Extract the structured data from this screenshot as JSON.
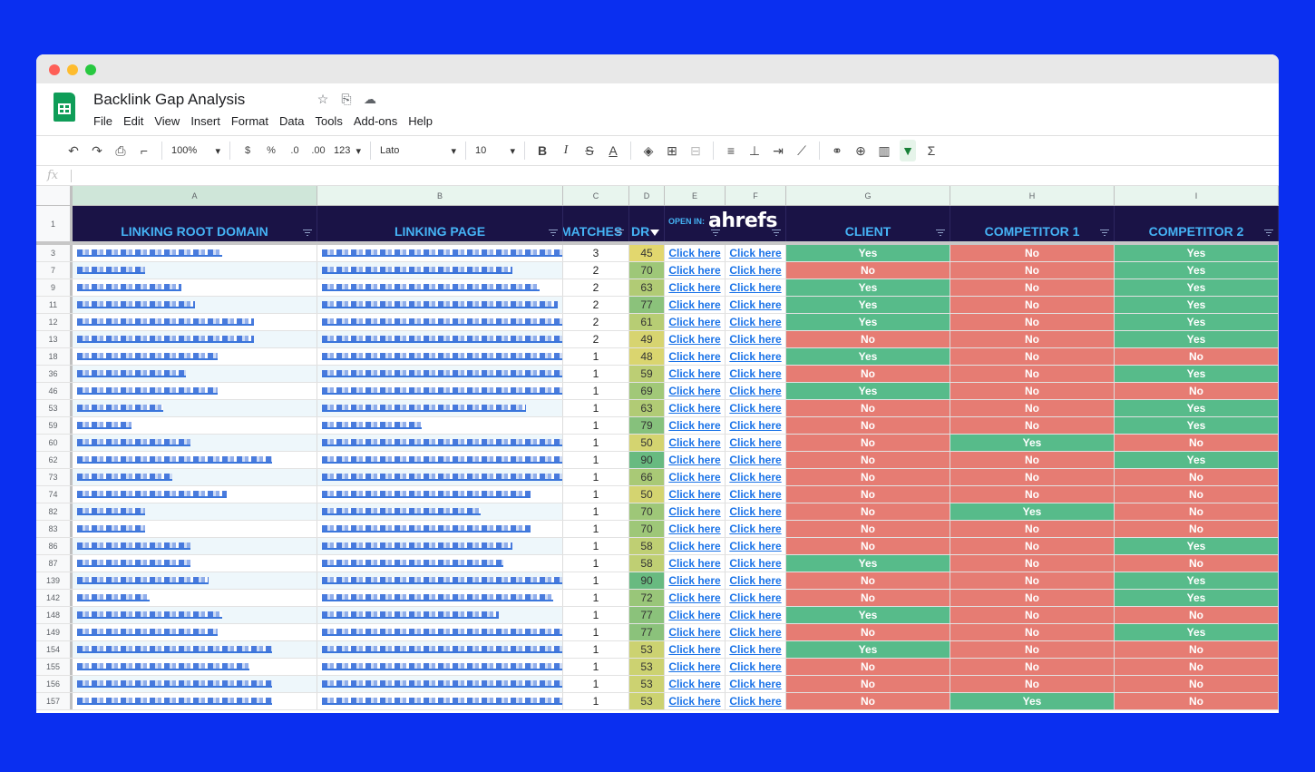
{
  "doc": {
    "title": "Backlink Gap Analysis",
    "menu": [
      "File",
      "Edit",
      "View",
      "Insert",
      "Format",
      "Data",
      "Tools",
      "Add-ons",
      "Help"
    ]
  },
  "toolbar": {
    "zoom": "100%",
    "currency": "$",
    "percent": "%",
    "dec_decrease": ".0",
    "dec_increase": ".00",
    "format_more": "123",
    "font": "Lato",
    "font_size": "10"
  },
  "formula": {
    "fx": "fx"
  },
  "columns": [
    "A",
    "B",
    "C",
    "D",
    "E",
    "F",
    "G",
    "H",
    "I"
  ],
  "header_row_number": "1",
  "headers": {
    "a": "LINKING ROOT DOMAIN",
    "b": "LINKING PAGE",
    "c": "MATCHES",
    "d": "DR",
    "e_open": "OPEN IN:",
    "e_brand": "ahrefs",
    "g": "CLIENT",
    "h": "COMPETITOR 1",
    "i": "COMPETITOR 2"
  },
  "link_text": "Click here",
  "colors": {
    "yes": "#57bb8a",
    "no": "#e67c73",
    "header_bg": "#1a1346",
    "header_text": "#45b3f5"
  },
  "rows": [
    {
      "n": "3",
      "matches": "3",
      "dr": 45,
      "client": "Yes",
      "c1": "No",
      "c2": "Yes"
    },
    {
      "n": "7",
      "matches": "2",
      "dr": 70,
      "client": "No",
      "c1": "No",
      "c2": "Yes"
    },
    {
      "n": "9",
      "matches": "2",
      "dr": 63,
      "client": "Yes",
      "c1": "No",
      "c2": "Yes"
    },
    {
      "n": "11",
      "matches": "2",
      "dr": 77,
      "client": "Yes",
      "c1": "No",
      "c2": "Yes"
    },
    {
      "n": "12",
      "matches": "2",
      "dr": 61,
      "client": "Yes",
      "c1": "No",
      "c2": "Yes"
    },
    {
      "n": "13",
      "matches": "2",
      "dr": 49,
      "client": "No",
      "c1": "No",
      "c2": "Yes"
    },
    {
      "n": "18",
      "matches": "1",
      "dr": 48,
      "client": "Yes",
      "c1": "No",
      "c2": "No"
    },
    {
      "n": "36",
      "matches": "1",
      "dr": 59,
      "client": "No",
      "c1": "No",
      "c2": "Yes"
    },
    {
      "n": "46",
      "matches": "1",
      "dr": 69,
      "client": "Yes",
      "c1": "No",
      "c2": "No"
    },
    {
      "n": "53",
      "matches": "1",
      "dr": 63,
      "client": "No",
      "c1": "No",
      "c2": "Yes"
    },
    {
      "n": "59",
      "matches": "1",
      "dr": 79,
      "client": "No",
      "c1": "No",
      "c2": "Yes"
    },
    {
      "n": "60",
      "matches": "1",
      "dr": 50,
      "client": "No",
      "c1": "Yes",
      "c2": "No"
    },
    {
      "n": "62",
      "matches": "1",
      "dr": 90,
      "client": "No",
      "c1": "No",
      "c2": "Yes"
    },
    {
      "n": "73",
      "matches": "1",
      "dr": 66,
      "client": "No",
      "c1": "No",
      "c2": "No"
    },
    {
      "n": "74",
      "matches": "1",
      "dr": 50,
      "client": "No",
      "c1": "No",
      "c2": "No"
    },
    {
      "n": "82",
      "matches": "1",
      "dr": 70,
      "client": "No",
      "c1": "Yes",
      "c2": "No"
    },
    {
      "n": "83",
      "matches": "1",
      "dr": 70,
      "client": "No",
      "c1": "No",
      "c2": "No"
    },
    {
      "n": "86",
      "matches": "1",
      "dr": 58,
      "client": "No",
      "c1": "No",
      "c2": "Yes"
    },
    {
      "n": "87",
      "matches": "1",
      "dr": 58,
      "client": "Yes",
      "c1": "No",
      "c2": "No"
    },
    {
      "n": "139",
      "matches": "1",
      "dr": 90,
      "client": "No",
      "c1": "No",
      "c2": "Yes"
    },
    {
      "n": "142",
      "matches": "1",
      "dr": 72,
      "client": "No",
      "c1": "No",
      "c2": "Yes"
    },
    {
      "n": "148",
      "matches": "1",
      "dr": 77,
      "client": "Yes",
      "c1": "No",
      "c2": "No"
    },
    {
      "n": "149",
      "matches": "1",
      "dr": 77,
      "client": "No",
      "c1": "No",
      "c2": "Yes"
    },
    {
      "n": "154",
      "matches": "1",
      "dr": 53,
      "client": "Yes",
      "c1": "No",
      "c2": "No"
    },
    {
      "n": "155",
      "matches": "1",
      "dr": 53,
      "client": "No",
      "c1": "No",
      "c2": "No"
    },
    {
      "n": "156",
      "matches": "1",
      "dr": 53,
      "client": "No",
      "c1": "No",
      "c2": "No"
    },
    {
      "n": "157",
      "matches": "1",
      "dr": 53,
      "client": "No",
      "c1": "Yes",
      "c2": "No"
    }
  ]
}
